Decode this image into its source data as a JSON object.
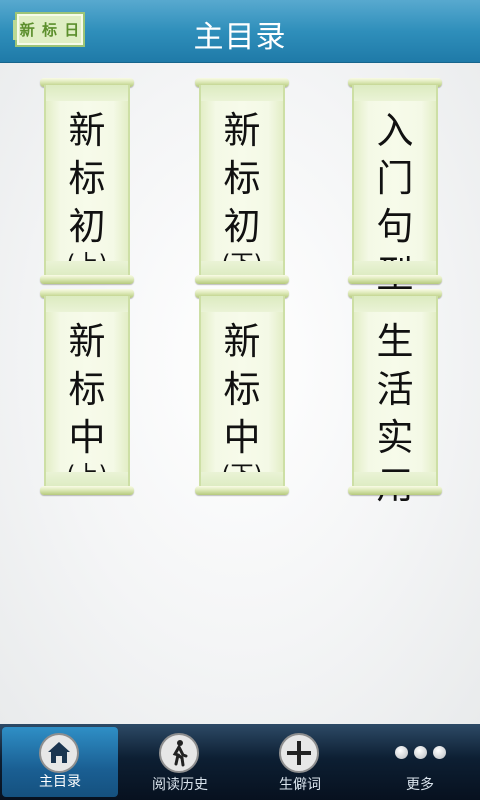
{
  "header": {
    "logo_text": "新 标 日",
    "title": "主目录"
  },
  "books": [
    {
      "chars": [
        "新",
        "标",
        "初"
      ],
      "sub": "(上)"
    },
    {
      "chars": [
        "新",
        "标",
        "初"
      ],
      "sub": "(下)"
    },
    {
      "chars": [
        "入",
        "门",
        "句",
        "型"
      ],
      "sub": ""
    },
    {
      "chars": [
        "新",
        "标",
        "中"
      ],
      "sub": "(上)"
    },
    {
      "chars": [
        "新",
        "标",
        "中"
      ],
      "sub": "(下)"
    },
    {
      "chars": [
        "生",
        "活",
        "实",
        "用"
      ],
      "sub": ""
    }
  ],
  "tabs": [
    {
      "label": "主目录",
      "icon": "home-icon",
      "active": true
    },
    {
      "label": "阅读历史",
      "icon": "walking-person-icon",
      "active": false
    },
    {
      "label": "生僻词",
      "icon": "plus-icon",
      "active": false
    },
    {
      "label": "更多",
      "icon": "more-dots-icon",
      "active": false
    }
  ],
  "colors": {
    "header": "#2f8fbb",
    "tabbar": "#0d1f33",
    "active_tab": "#2f8fc6",
    "scroll_paper": "#f4f9e6"
  }
}
